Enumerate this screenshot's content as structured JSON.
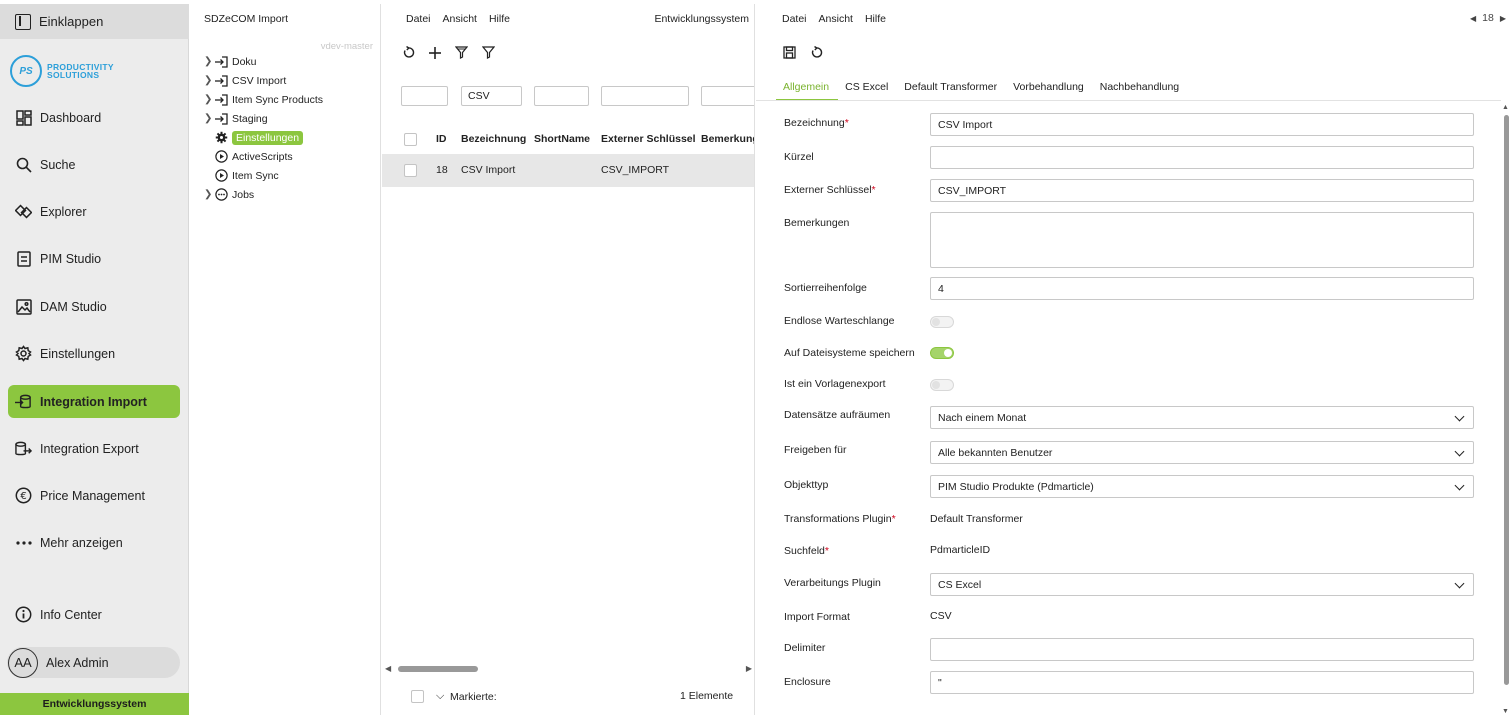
{
  "nav": {
    "collapse_label": "Einklappen",
    "logo": {
      "mark": "PS",
      "line1": "PRODUCTIVITY",
      "line2": "SOLUTIONS"
    },
    "items": [
      {
        "label": "Dashboard",
        "icon": "dashboard-icon"
      },
      {
        "label": "Suche",
        "icon": "search-icon"
      },
      {
        "label": "Explorer",
        "icon": "explorer-icon"
      },
      {
        "label": "PIM Studio",
        "icon": "pim-studio-icon"
      },
      {
        "label": "DAM Studio",
        "icon": "image-icon"
      },
      {
        "label": "Einstellungen",
        "icon": "gear-icon"
      },
      {
        "label": "Integration Import",
        "icon": "import-icon",
        "active": true
      },
      {
        "label": "Integration Export",
        "icon": "export-icon"
      },
      {
        "label": "Price Management",
        "icon": "euro-icon"
      },
      {
        "label": "Mehr anzeigen",
        "icon": "more-icon"
      }
    ],
    "info_center": "Info Center",
    "user": {
      "initials": "AA",
      "name": "Alex Admin"
    },
    "environment": "Entwicklungssystem",
    "accent_color": "#8cc63f"
  },
  "tree": {
    "title": "SDZeCOM Import",
    "branch": "vdev-master",
    "items": [
      {
        "label": "Doku",
        "icon": "import-icon",
        "expandable": true
      },
      {
        "label": "CSV Import",
        "icon": "import-icon",
        "expandable": true
      },
      {
        "label": "Item Sync Products",
        "icon": "import-icon",
        "expandable": true
      },
      {
        "label": "Staging",
        "icon": "import-icon",
        "expandable": true
      },
      {
        "label": "Einstellungen",
        "icon": "gear-icon",
        "expandable": false,
        "selected": true
      },
      {
        "label": "ActiveScripts",
        "icon": "play-icon",
        "expandable": false
      },
      {
        "label": "Item Sync",
        "icon": "play-icon",
        "expandable": false
      },
      {
        "label": "Jobs",
        "icon": "jobs-icon",
        "expandable": true
      }
    ]
  },
  "list": {
    "menu": [
      "Datei",
      "Ansicht",
      "Hilfe"
    ],
    "environment": "Entwicklungssystem",
    "filters": [
      "",
      "CSV",
      "",
      "",
      ""
    ],
    "columns": [
      "ID",
      "Bezeichnung",
      "ShortName",
      "Externer Schlüssel",
      "Bemerkung"
    ],
    "rows": [
      {
        "id": "18",
        "bezeichnung": "CSV Import",
        "shortname": "",
        "externer_schluessel": "CSV_IMPORT",
        "bemerkung": ""
      }
    ],
    "footer_label": "Markierte:",
    "footer_count": "1 Elemente"
  },
  "detail": {
    "menu": [
      "Datei",
      "Ansicht",
      "Hilfe"
    ],
    "record_number": "18",
    "tabs": [
      "Allgemein",
      "CS Excel",
      "Default Transformer",
      "Vorbehandlung",
      "Nachbehandlung"
    ],
    "fields": {
      "bezeichnung": {
        "label": "Bezeichnung",
        "value": "CSV Import",
        "required": "*"
      },
      "kuerzel": {
        "label": "Kürzel",
        "value": ""
      },
      "externer_schluessel": {
        "label": "Externer Schlüssel",
        "value": "CSV_IMPORT",
        "required": "*"
      },
      "bemerkungen": {
        "label": "Bemerkungen",
        "value": ""
      },
      "sortierreihenfolge": {
        "label": "Sortierreihenfolge",
        "value": "4"
      },
      "endlose_warteschlange": {
        "label": "Endlose Warteschlange",
        "on": false
      },
      "auf_dateisysteme": {
        "label": "Auf Dateisysteme speichern",
        "on": true
      },
      "vorlagenexport": {
        "label": "Ist ein Vorlagenexport",
        "on": false
      },
      "datensaetze": {
        "label": "Datensätze aufräumen",
        "value": "Nach einem Monat"
      },
      "freigeben": {
        "label": "Freigeben für",
        "value": "Alle bekannten Benutzer"
      },
      "objekttyp": {
        "label": "Objekttyp",
        "value": "PIM Studio Produkte (Pdmarticle)"
      },
      "transformations_plugin": {
        "label": "Transformations Plugin",
        "value": "Default Transformer",
        "required": "*"
      },
      "suchfeld": {
        "label": "Suchfeld",
        "value": "PdmarticleID",
        "required": "*"
      },
      "verarbeitungs_plugin": {
        "label": "Verarbeitungs Plugin",
        "value": "CS Excel"
      },
      "import_format": {
        "label": "Import Format",
        "value": "CSV"
      },
      "delimiter": {
        "label": "Delimiter",
        "value": ""
      },
      "enclosure": {
        "label": "Enclosure",
        "value": "\""
      }
    }
  }
}
